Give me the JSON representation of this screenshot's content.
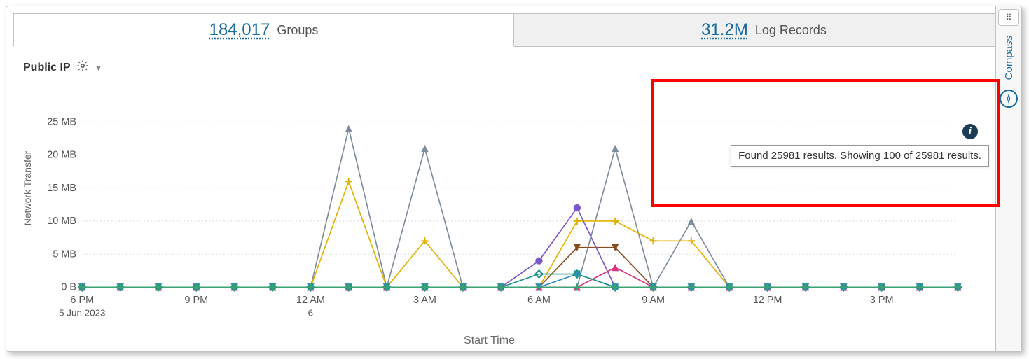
{
  "tabs": {
    "groups": {
      "count": "184,017",
      "label": "Groups"
    },
    "log_records": {
      "count": "31.2M",
      "label": "Log Records"
    }
  },
  "rail": {
    "label": "Compass"
  },
  "panel": {
    "title": "Public IP"
  },
  "info": {
    "tooltip": "Found 25981 results. Showing 100 of 25981 results."
  },
  "chart_data": {
    "type": "line",
    "title": "",
    "xlabel": "Start Time",
    "ylabel": "Network Transfer",
    "ylim": [
      0,
      25
    ],
    "y_unit": "MB",
    "y_ticks": [
      {
        "v": 0,
        "label": "0 B"
      },
      {
        "v": 5,
        "label": "5 MB"
      },
      {
        "v": 10,
        "label": "10 MB"
      },
      {
        "v": 15,
        "label": "15 MB"
      },
      {
        "v": 20,
        "label": "20 MB"
      },
      {
        "v": 25,
        "label": "25 MB"
      }
    ],
    "x_categories": [
      "6 PM",
      "7 PM",
      "8 PM",
      "9 PM",
      "10 PM",
      "11 PM",
      "12 AM",
      "1 AM",
      "2 AM",
      "3 AM",
      "4 AM",
      "5 AM",
      "6 AM",
      "7 AM",
      "8 AM",
      "9 AM",
      "10 AM",
      "11 AM",
      "12 PM",
      "1 PM",
      "2 PM",
      "3 PM",
      "4 PM",
      "5 PM"
    ],
    "x_ticks_major": [
      "6 PM",
      "9 PM",
      "12 AM",
      "3 AM",
      "6 AM",
      "9 AM",
      "12 PM",
      "3 PM"
    ],
    "x_tick_sub": {
      "6 PM": "5 Jun 2023",
      "12 AM": "6"
    },
    "series": [
      {
        "name": "series-gray",
        "color": "#7f8c9b",
        "marker": "triangle",
        "values": [
          0,
          0,
          0,
          0,
          0,
          0,
          0,
          24,
          0,
          21,
          0,
          0,
          0,
          0,
          21,
          0,
          10,
          0,
          0,
          0,
          0,
          0,
          0,
          0
        ]
      },
      {
        "name": "series-yellow",
        "color": "#e3b200",
        "marker": "plus",
        "values": [
          0,
          0,
          0,
          0,
          0,
          0,
          0,
          16,
          0,
          7,
          0,
          0,
          0,
          10,
          10,
          7,
          7,
          0,
          0,
          0,
          0,
          0,
          0,
          0
        ]
      },
      {
        "name": "series-brown",
        "color": "#8a4b1f",
        "marker": "tri-down",
        "values": [
          0,
          0,
          0,
          0,
          0,
          0,
          0,
          0,
          0,
          0,
          0,
          0,
          0,
          6,
          6,
          0,
          0,
          0,
          0,
          0,
          0,
          0,
          0,
          0
        ]
      },
      {
        "name": "series-purple",
        "color": "#7b56c5",
        "marker": "circle",
        "values": [
          0,
          0,
          0,
          0,
          0,
          0,
          0,
          0,
          0,
          0,
          0,
          0,
          4,
          12,
          0,
          0,
          0,
          0,
          0,
          0,
          0,
          0,
          0,
          0
        ]
      },
      {
        "name": "series-magenta",
        "color": "#d63384",
        "marker": "triangle",
        "values": [
          0,
          0,
          0,
          0,
          0,
          0,
          0,
          0,
          0,
          0,
          0,
          0,
          0,
          0,
          3,
          0,
          0,
          0,
          0,
          0,
          0,
          0,
          0,
          0
        ]
      },
      {
        "name": "series-blue",
        "color": "#2d8bc0",
        "marker": "tri-down",
        "values": [
          0,
          0,
          0,
          0,
          0,
          0,
          0,
          0,
          0,
          0,
          0,
          0,
          0,
          2,
          0,
          0,
          0,
          0,
          0,
          0,
          0,
          0,
          0,
          0
        ]
      },
      {
        "name": "series-teal",
        "color": "#1f948b",
        "marker": "diamond",
        "values": [
          0,
          0,
          0,
          0,
          0,
          0,
          0,
          0,
          0,
          0,
          0,
          0,
          2,
          2,
          0,
          0,
          0,
          0,
          0,
          0,
          0,
          0,
          0,
          0
        ]
      },
      {
        "name": "series-green",
        "color": "#3ba272",
        "marker": "plus",
        "values": [
          0,
          0,
          0,
          0,
          0,
          0,
          0,
          0,
          0,
          0,
          0,
          0,
          0,
          0,
          0,
          0,
          0,
          0,
          0,
          0,
          0,
          0,
          0,
          0
        ]
      }
    ]
  }
}
